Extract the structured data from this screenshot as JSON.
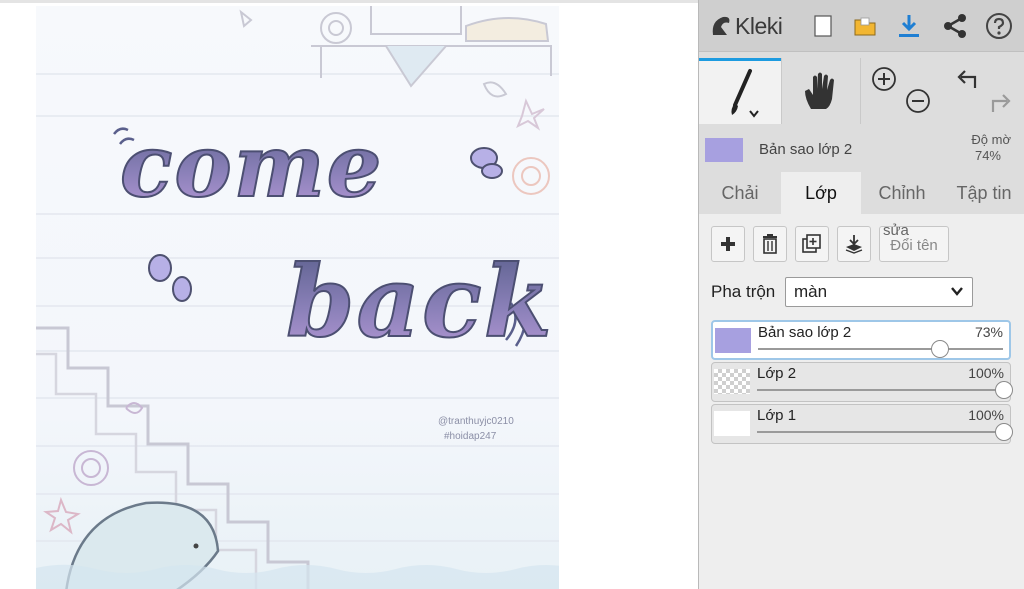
{
  "app": {
    "name": "Kleki"
  },
  "canvas": {
    "title_line1": "come",
    "title_line2": "back",
    "watermark_user": "@tranthuyjc0210",
    "watermark_tag": "#hoidap247"
  },
  "toolbar": {
    "icons": [
      "kleki-logo-icon",
      "new-file-icon",
      "open-folder-icon",
      "download-icon",
      "share-icon",
      "help-icon"
    ],
    "colors": {
      "folder": "#f2b632",
      "download": "#1f7fd3",
      "accent": "#1d9be0"
    }
  },
  "tools": {
    "brush": "brush-icon",
    "hand": "hand-icon",
    "zoom_in": "zoom-in-icon",
    "zoom_out": "zoom-out-icon",
    "undo": "undo-icon",
    "redo": "redo-icon"
  },
  "current_layer": {
    "name": "Bản sao lớp 2",
    "opacity_label": "Độ mờ",
    "opacity_value": "74%"
  },
  "tabs": [
    {
      "label": "Chải"
    },
    {
      "label": "Lớp"
    },
    {
      "label": "Chỉnh"
    },
    {
      "label": "Tập tin"
    }
  ],
  "layer_buttons": {
    "rename_label": "Đổi tên",
    "rename_overlay": "sửa"
  },
  "blend": {
    "label": "Pha trộn",
    "value": "màn"
  },
  "layers": [
    {
      "name": "Bản sao lớp 2",
      "opacity": "73%",
      "value": 0.73
    },
    {
      "name": "Lớp 2",
      "opacity": "100%",
      "value": 1.0
    },
    {
      "name": "Lớp 1",
      "opacity": "100%",
      "value": 1.0
    }
  ]
}
